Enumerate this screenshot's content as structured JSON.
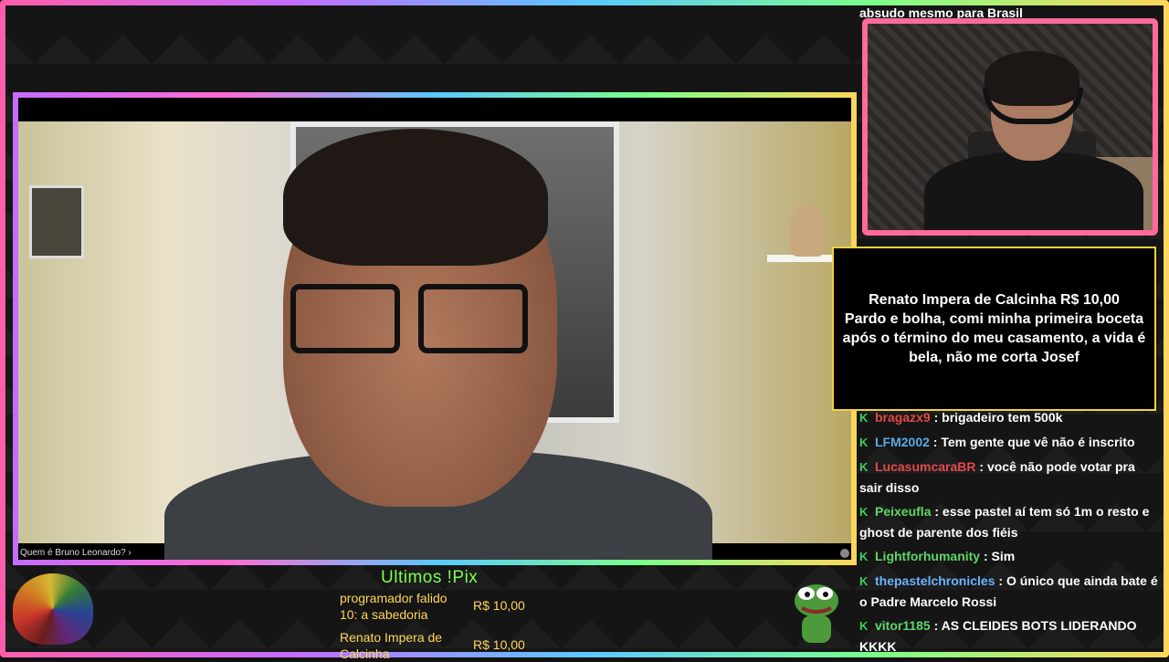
{
  "video": {
    "caption": "Quem é Bruno Leonardo? ›"
  },
  "chat": {
    "top_line": "absudo mesmo para Brasil",
    "messages": [
      {
        "user": "bragazx9",
        "text": " : brigadeiro tem 500k",
        "color": "#e24a4a"
      },
      {
        "user": "LFM2002",
        "text": " : Tem gente que vê não é inscrito",
        "color": "#5aa8e6"
      },
      {
        "user": "LucasumcaraBR",
        "text": " : você não pode votar pra sair disso",
        "color": "#e24a4a"
      },
      {
        "user": "Peixeufla",
        "text": " : esse pastel aí tem só 1m o resto e ghost de parente dos fiéis",
        "color": "#5fd66a"
      },
      {
        "user": "Lightforhumanity",
        "text": " : Sim",
        "color": "#5fd66a"
      },
      {
        "user": "thepastelchronicles",
        "text": " : O único que ainda bate é o Padre Marcelo Rossi",
        "color": "#6ab4ff"
      },
      {
        "user": "vitor1185",
        "text": " : AS CLEIDES BOTS LIDERANDO KKKK",
        "color": "#5fd66a"
      }
    ],
    "badge_glyph": "K"
  },
  "alert": {
    "line1": "Renato Impera de Calcinha R$ 10,00",
    "line2": "Pardo e bolha, comi minha primeira boceta após o término do meu casamento, a vida é bela, não me corta Josef"
  },
  "pix": {
    "title": "Ultimos !Pix",
    "items": [
      {
        "name": "programador falido 10: a sabedoria",
        "amount": "R$ 10,00"
      },
      {
        "name": "Renato Impera de Calcinha",
        "amount": "R$ 10,00"
      }
    ]
  },
  "colors": {
    "pix_title": "#7dff4e",
    "pix_text": "#ffd65a",
    "alert_border": "#f3d23a",
    "webcam_border": "#ff6a9a"
  },
  "icons": {
    "bottom_left": "rainbow-creature-icon",
    "bottom_right": "pepe-frog-icon"
  }
}
